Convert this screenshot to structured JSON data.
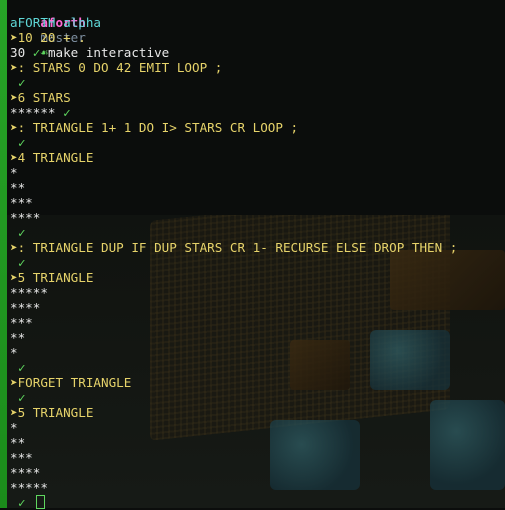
{
  "header": {
    "repo": "aforth",
    "branch": "master",
    "branch_icon": "leaf-icon",
    "command": "make interactive",
    "banner": "aFORTH alpha"
  },
  "colors": {
    "prompt": "#e6d36a",
    "check": "#5fd75f",
    "banner": "#5fd7d7",
    "repo": "#ff6ad5",
    "sidebar_bar": "#27a327"
  },
  "prompt_glyph": "➤",
  "check_glyph": "✓",
  "lines": [
    {
      "kind": "input",
      "text": "10 20 + ."
    },
    {
      "kind": "output",
      "text": "30 ",
      "check": true
    },
    {
      "kind": "input",
      "text": ": STARS 0 DO 42 EMIT LOOP ;"
    },
    {
      "kind": "check"
    },
    {
      "kind": "input",
      "text": "6 STARS"
    },
    {
      "kind": "output",
      "text": "****** ",
      "check": true
    },
    {
      "kind": "input",
      "text": ": TRIANGLE 1+ 1 DO I> STARS CR LOOP ;"
    },
    {
      "kind": "check"
    },
    {
      "kind": "input",
      "text": "4 TRIANGLE"
    },
    {
      "kind": "output",
      "text": "*"
    },
    {
      "kind": "output",
      "text": "**"
    },
    {
      "kind": "output",
      "text": "***"
    },
    {
      "kind": "output",
      "text": "****"
    },
    {
      "kind": "check"
    },
    {
      "kind": "input",
      "text": ": TRIANGLE DUP IF DUP STARS CR 1- RECURSE ELSE DROP THEN ;"
    },
    {
      "kind": "check"
    },
    {
      "kind": "input",
      "text": "5 TRIANGLE"
    },
    {
      "kind": "output",
      "text": "*****"
    },
    {
      "kind": "output",
      "text": "****"
    },
    {
      "kind": "output",
      "text": "***"
    },
    {
      "kind": "output",
      "text": "**"
    },
    {
      "kind": "output",
      "text": "*"
    },
    {
      "kind": "check"
    },
    {
      "kind": "input",
      "text": "FORGET TRIANGLE"
    },
    {
      "kind": "check"
    },
    {
      "kind": "input",
      "text": "5 TRIANGLE"
    },
    {
      "kind": "output",
      "text": "*"
    },
    {
      "kind": "output",
      "text": "**"
    },
    {
      "kind": "output",
      "text": "***"
    },
    {
      "kind": "output",
      "text": "****"
    },
    {
      "kind": "output",
      "text": "*****"
    },
    {
      "kind": "check"
    }
  ]
}
